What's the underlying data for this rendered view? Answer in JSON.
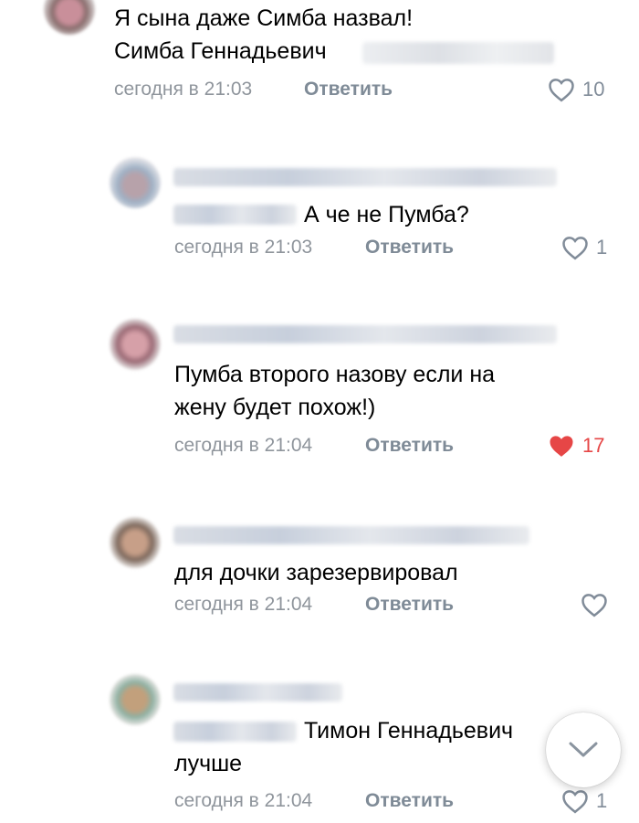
{
  "comments": [
    {
      "lines": [
        "Я сына даже Симба назвал!",
        "Симба Геннадьевич"
      ],
      "time": "сегодня в 21:03",
      "reply_label": "Ответить",
      "likes": "10",
      "liked": false
    },
    {
      "lines": [
        "А че не Пумба?"
      ],
      "time": "сегодня в 21:03",
      "reply_label": "Ответить",
      "likes": "1",
      "liked": false
    },
    {
      "lines": [
        "Пумба второго назову если на",
        "жену будет похож!)"
      ],
      "time": "сегодня в 21:04",
      "reply_label": "Ответить",
      "likes": "17",
      "liked": true
    },
    {
      "lines": [
        "для дочки зарезервировал"
      ],
      "time": "сегодня в 21:04",
      "reply_label": "Ответить",
      "likes": "",
      "liked": false
    },
    {
      "lines": [
        "Тимон Геннадьевич",
        "лучше"
      ],
      "time": "сегодня в 21:04",
      "reply_label": "Ответить",
      "likes": "1",
      "liked": false
    }
  ],
  "colors": {
    "meta_gray": "#8f959c",
    "reply_gray": "#7f8b97",
    "like_red": "#e64646"
  },
  "icons": [
    "heart-icon",
    "chevron-down-icon"
  ]
}
